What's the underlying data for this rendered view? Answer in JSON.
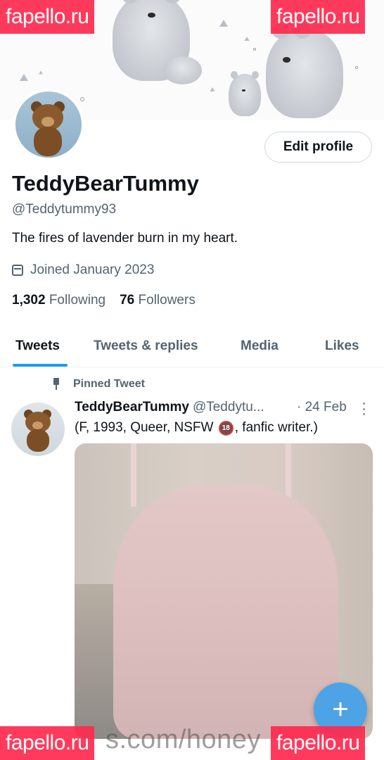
{
  "watermark": {
    "text": "fapello.ru",
    "bottom_middle": "s.com/honey"
  },
  "profile": {
    "display_name": "TeddyBearTummy",
    "handle": "@Teddytummy93",
    "bio": "The fires of lavender burn in my heart.",
    "joined": "Joined January 2023",
    "following_count": "1,302",
    "following_label": "Following",
    "followers_count": "76",
    "followers_label": "Followers",
    "edit_button": "Edit profile"
  },
  "tabs": [
    {
      "label": "Tweets",
      "active": true
    },
    {
      "label": "Tweets & replies",
      "active": false
    },
    {
      "label": "Media",
      "active": false
    },
    {
      "label": "Likes",
      "active": false
    }
  ],
  "pinned_tweet": {
    "pinned_label": "Pinned Tweet",
    "author_name": "TeddyBearTummy",
    "author_handle": "@Teddytu...",
    "date": "· 24 Feb",
    "text_before": "(F, 1993, Queer, NSFW ",
    "badge": "18",
    "text_after": ", fanfic writer.)"
  },
  "fab": {
    "icon": "plus-icon",
    "symbol": "+"
  },
  "colors": {
    "accent": "#1d9bf0",
    "watermark": "#ff2a4f",
    "muted": "#536471",
    "fab": "#4ea3e6"
  }
}
